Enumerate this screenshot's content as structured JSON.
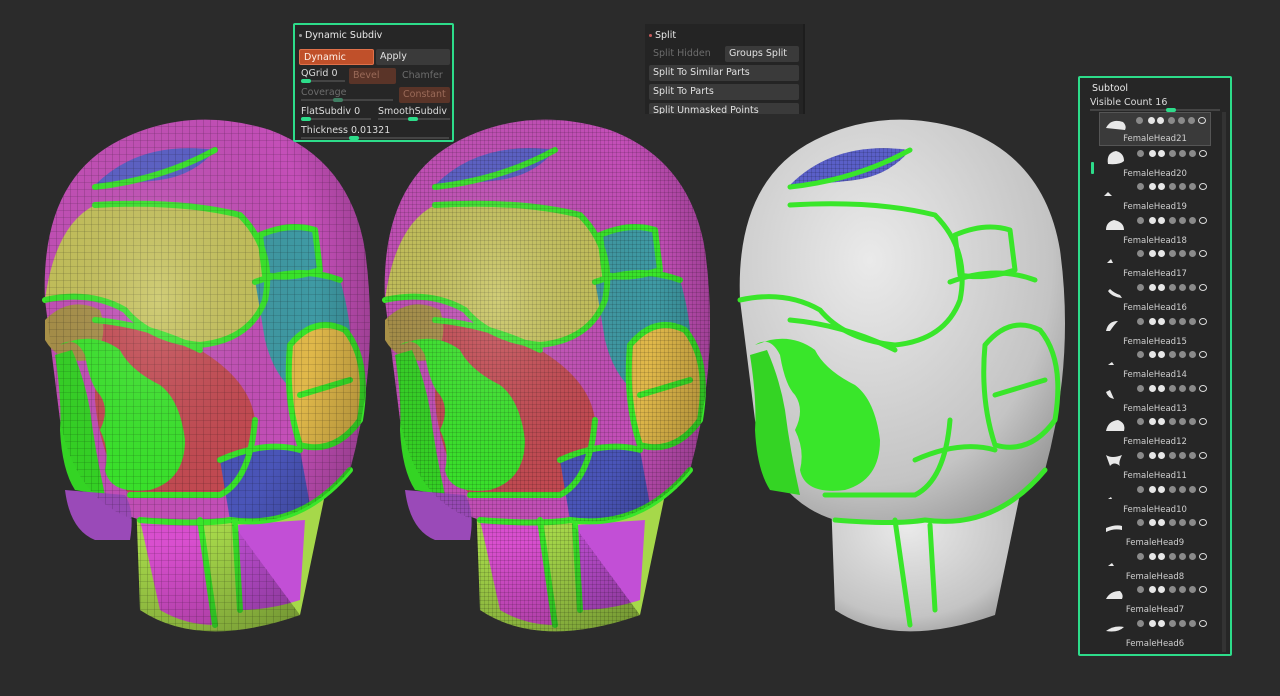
{
  "dynamic_subdiv": {
    "title": "Dynamic Subdiv",
    "dynamic_label": "Dynamic",
    "apply_label": "Apply",
    "qgrid_label": "QGrid",
    "qgrid_value": "0",
    "bevel_label": "Bevel",
    "chamfer_label": "Chamfer",
    "coverage_label": "Coverage",
    "constant_label": "Constant",
    "flatsubdiv_label": "FlatSubdiv",
    "flatsubdiv_value": "0",
    "smoothsubdiv_label": "SmoothSubdiv",
    "thickness_label": "Thickness",
    "thickness_value": "0.01321"
  },
  "split": {
    "title": "Split",
    "split_hidden_label": "Split Hidden",
    "groups_split_label": "Groups Split",
    "split_similar_label": "Split To Similar Parts",
    "split_parts_label": "Split To Parts",
    "split_unmasked_label": "Split Unmasked Points"
  },
  "subtool": {
    "title": "Subtool",
    "visible_count_label": "Visible Count",
    "visible_count_value": "16",
    "items": [
      {
        "label": "FemaleHead21"
      },
      {
        "label": "FemaleHead20"
      },
      {
        "label": "FemaleHead19"
      },
      {
        "label": "FemaleHead18"
      },
      {
        "label": "FemaleHead17"
      },
      {
        "label": "FemaleHead16"
      },
      {
        "label": "FemaleHead15"
      },
      {
        "label": "FemaleHead14"
      },
      {
        "label": "FemaleHead13"
      },
      {
        "label": "FemaleHead12"
      },
      {
        "label": "FemaleHead11"
      },
      {
        "label": "FemaleHead10"
      },
      {
        "label": "FemaleHead9"
      },
      {
        "label": "FemaleHead8"
      },
      {
        "label": "FemaleHead7"
      },
      {
        "label": "FemaleHead6"
      }
    ]
  },
  "colors": {
    "background": "#2b2b2b",
    "highlight": "#2ddc8a",
    "accent_orange": "#c0502a",
    "polygroup_green": "#39e62a"
  }
}
